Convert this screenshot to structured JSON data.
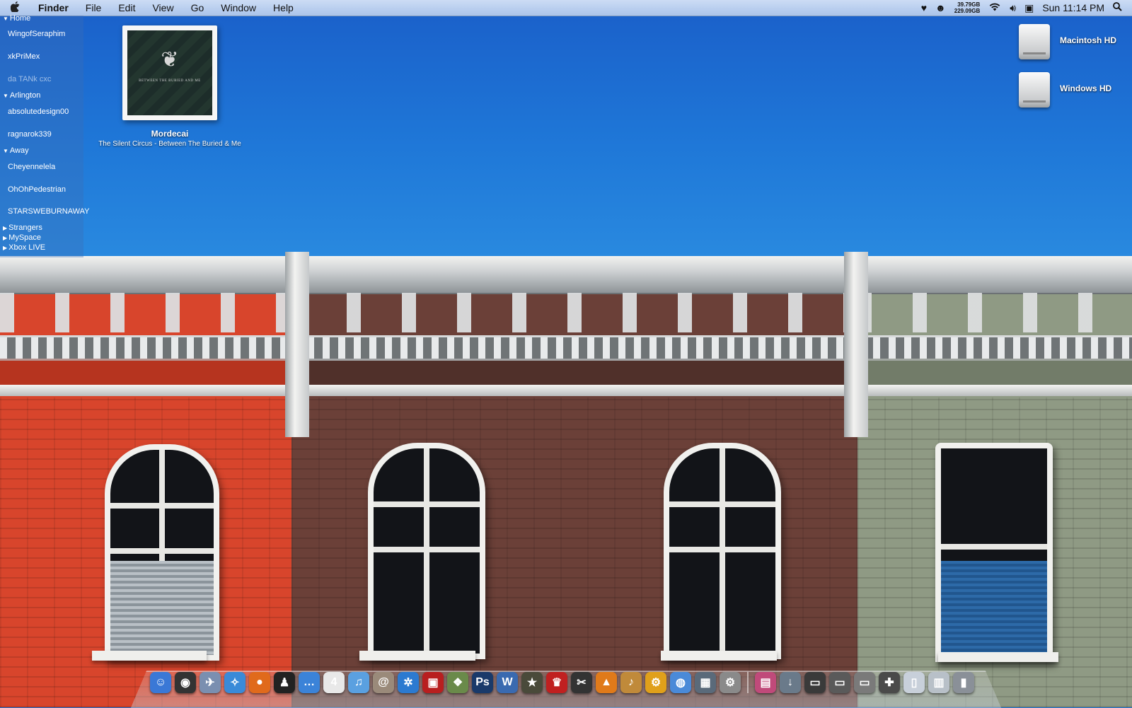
{
  "menubar": {
    "app_name": "Finder",
    "items": [
      "File",
      "Edit",
      "View",
      "Go",
      "Window",
      "Help"
    ],
    "disk_used": "39.79GB",
    "disk_total": "229.09GB",
    "clock": "Sun 11:14 PM"
  },
  "buddy_list": {
    "groups": [
      {
        "name": "Home",
        "expanded": true,
        "buddies": [
          {
            "name": "WingofSeraphim",
            "idle": false
          },
          {
            "name": "xkPriMex",
            "idle": false
          },
          {
            "name": "da TANk cxc",
            "idle": true
          }
        ]
      },
      {
        "name": "Arlington",
        "expanded": true,
        "buddies": [
          {
            "name": "absolutedesign00",
            "idle": false
          },
          {
            "name": "ragnarok339",
            "idle": false
          }
        ]
      },
      {
        "name": "Away",
        "expanded": true,
        "buddies": [
          {
            "name": "Cheyennelela",
            "idle": false
          },
          {
            "name": "OhOhPedestrian",
            "idle": false
          },
          {
            "name": "STARSWEBURNAWAY",
            "idle": false
          }
        ]
      },
      {
        "name": "Strangers",
        "expanded": false,
        "buddies": []
      },
      {
        "name": "MySpace",
        "expanded": false,
        "buddies": []
      },
      {
        "name": "Xbox LIVE",
        "expanded": false,
        "buddies": []
      }
    ]
  },
  "now_playing": {
    "track": "Mordecai",
    "album_artist": "The Silent Circus - Between The Buried & Me",
    "cover_caption": "BETWEEN THE BURIED AND ME"
  },
  "desktop": {
    "drives": [
      {
        "label": "Macintosh HD"
      },
      {
        "label": "Windows HD"
      }
    ]
  },
  "dock": {
    "apps": [
      {
        "icon": "finder-icon",
        "glyph": "☺",
        "color": "#3a78d6"
      },
      {
        "icon": "dashboard-icon",
        "glyph": "◉",
        "color": "#333333"
      },
      {
        "icon": "mail-icon",
        "glyph": "✈",
        "color": "#7a8fb0"
      },
      {
        "icon": "safari-icon",
        "glyph": "✧",
        "color": "#3a8ad8"
      },
      {
        "icon": "firefox-icon",
        "glyph": "●",
        "color": "#e06a1c"
      },
      {
        "icon": "adium-icon",
        "glyph": "♟",
        "color": "#222222"
      },
      {
        "icon": "ichat-icon",
        "glyph": "…",
        "color": "#3b83d8"
      },
      {
        "icon": "ical-icon",
        "glyph": "4",
        "color": "#e8e8e8"
      },
      {
        "icon": "itunes-icon",
        "glyph": "♫",
        "color": "#5aa0e0"
      },
      {
        "icon": "address-book-icon",
        "glyph": "@",
        "color": "#9a8a7a"
      },
      {
        "icon": "transmission-icon",
        "glyph": "✲",
        "color": "#2c7ad0"
      },
      {
        "icon": "photo-booth-icon",
        "glyph": "▣",
        "color": "#b81f1f"
      },
      {
        "icon": "iphoto-icon",
        "glyph": "❖",
        "color": "#6a8a4a"
      },
      {
        "icon": "photoshop-icon",
        "glyph": "Ps",
        "color": "#1a3a6a"
      },
      {
        "icon": "word-icon",
        "glyph": "W",
        "color": "#3a6ab0"
      },
      {
        "icon": "imovie-icon",
        "glyph": "★",
        "color": "#4a4a3a"
      },
      {
        "icon": "front-row-icon",
        "glyph": "♛",
        "color": "#c02020"
      },
      {
        "icon": "final-cut-icon",
        "glyph": "✂",
        "color": "#333333"
      },
      {
        "icon": "vlc-icon",
        "glyph": "▲",
        "color": "#e07a1a"
      },
      {
        "icon": "garageband-icon",
        "glyph": "♪",
        "color": "#c08a3a"
      },
      {
        "icon": "system-prefs-gear-icon",
        "glyph": "⚙",
        "color": "#e0a01a"
      },
      {
        "icon": "network-globe-icon",
        "glyph": "◍",
        "color": "#4a8ad8"
      },
      {
        "icon": "expose-spaces-icon",
        "glyph": "▦",
        "color": "#5a6a7a"
      },
      {
        "icon": "system-preferences-icon",
        "glyph": "⚙",
        "color": "#8a8a8a"
      }
    ],
    "stacks": [
      {
        "icon": "applications-stack-icon",
        "glyph": "▤",
        "color": "#c04a7a"
      },
      {
        "icon": "downloads-stack-icon",
        "glyph": "↓",
        "color": "#6a7a8a"
      },
      {
        "icon": "documents-folder-icon",
        "glyph": "▭",
        "color": "#3a3a3a"
      },
      {
        "icon": "movies-folder-icon",
        "glyph": "▭",
        "color": "#5a5a5a"
      },
      {
        "icon": "pictures-folder-icon",
        "glyph": "▭",
        "color": "#7a7a7a"
      },
      {
        "icon": "games-folder-icon",
        "glyph": "✚",
        "color": "#4a4a4a"
      },
      {
        "icon": "document-icon",
        "glyph": "▯",
        "color": "#c8d0da"
      },
      {
        "icon": "spreadsheet-icon",
        "glyph": "▥",
        "color": "#b8c0c8"
      },
      {
        "icon": "trash-icon",
        "glyph": "▮",
        "color": "#8a9098"
      }
    ]
  }
}
